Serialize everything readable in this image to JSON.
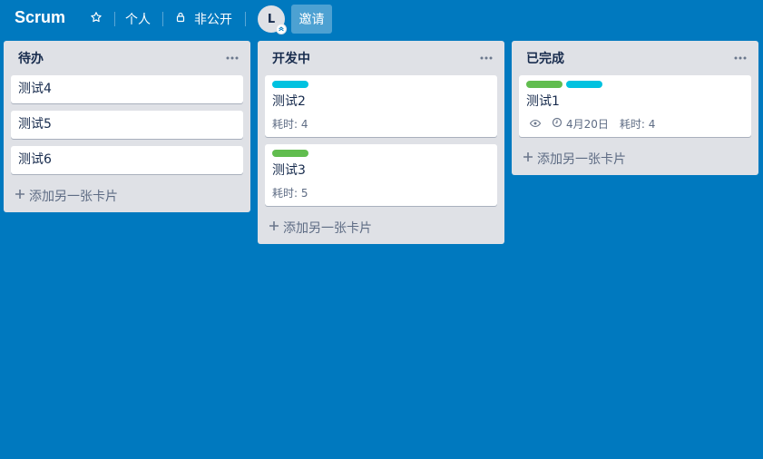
{
  "header": {
    "board_title": "Scrum",
    "star_icon": "star-icon",
    "team_label": "个人",
    "visibility_icon": "lock-icon",
    "visibility_label": "非公开",
    "avatar_initial": "L",
    "invite_label": "邀请"
  },
  "lists": [
    {
      "title": "待办",
      "cards": [
        {
          "title": "测试4"
        },
        {
          "title": "测试5"
        },
        {
          "title": "测试6"
        }
      ],
      "add_label": "添加另一张卡片"
    },
    {
      "title": "开发中",
      "cards": [
        {
          "title": "测试2",
          "labels": [
            "#00c2e0"
          ],
          "time": "耗时: 4"
        },
        {
          "title": "测试3",
          "labels": [
            "#61bd4f"
          ],
          "time": "耗时: 5"
        }
      ],
      "add_label": "添加另一张卡片"
    },
    {
      "title": "已完成",
      "cards": [
        {
          "title": "测试1",
          "labels": [
            "#61bd4f",
            "#00c2e0"
          ],
          "due": "4月20日",
          "time": "耗时: 4"
        }
      ],
      "add_label": "添加另一张卡片"
    }
  ],
  "colors": {
    "board_bg": "#0079bf",
    "list_bg": "#dfe1e6",
    "label_green": "#61bd4f",
    "label_cyan": "#00c2e0"
  }
}
